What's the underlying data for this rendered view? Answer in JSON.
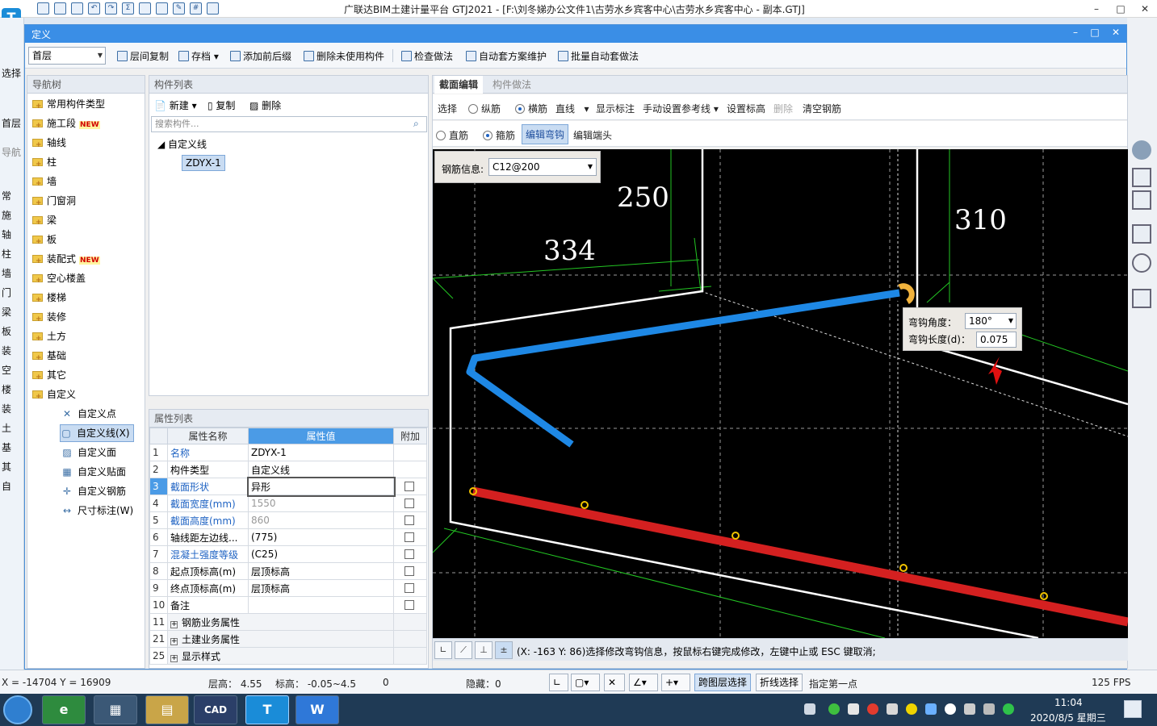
{
  "app": {
    "title": "广联达BIM土建计量平台 GTJ2021 - [F:\\刘冬娣办公文件1\\古劳水乡宾客中心\\古劳水乡宾客中心 - 副本.GTJ]",
    "logo": "T",
    "win_min": "–",
    "win_max": "□",
    "win_close": "✕",
    "bg_left_items": [
      "选择",
      "首层",
      "导航",
      "常",
      "施",
      "轴",
      "柱",
      "墙",
      "门",
      "梁",
      "板",
      "装",
      "空",
      "楼",
      "装",
      "土",
      "基",
      "其",
      "自"
    ]
  },
  "dialog": {
    "title": "定义",
    "floor": "首层",
    "toolbar": [
      "层间复制",
      "存档",
      "添加前后缀",
      "删除未使用构件",
      "检查做法",
      "自动套方案维护",
      "批量自动套做法"
    ]
  },
  "nav": {
    "header": "导航树",
    "items": [
      {
        "label": "常用构件类型",
        "new": ""
      },
      {
        "label": "施工段",
        "new": "NEW"
      },
      {
        "label": "轴线",
        "new": ""
      },
      {
        "label": "柱",
        "new": ""
      },
      {
        "label": "墙",
        "new": ""
      },
      {
        "label": "门窗洞",
        "new": ""
      },
      {
        "label": "梁",
        "new": ""
      },
      {
        "label": "板",
        "new": ""
      },
      {
        "label": "装配式",
        "new": "NEW"
      },
      {
        "label": "空心楼盖",
        "new": ""
      },
      {
        "label": "楼梯",
        "new": ""
      },
      {
        "label": "装修",
        "new": ""
      },
      {
        "label": "土方",
        "new": ""
      },
      {
        "label": "基础",
        "new": ""
      },
      {
        "label": "其它",
        "new": ""
      },
      {
        "label": "自定义",
        "new": ""
      }
    ],
    "sub_items": [
      "自定义点",
      "自定义线(X)",
      "自定义面",
      "自定义贴面",
      "自定义钢筋",
      "尺寸标注(W)"
    ]
  },
  "components": {
    "header": "构件列表",
    "new_label": "新建",
    "copy_label": "复制",
    "delete_label": "删除",
    "search_placeholder": "搜索构件...",
    "tree_root": "自定义线",
    "tree_child": "ZDYX-1"
  },
  "properties": {
    "header": "属性列表",
    "col_name": "属性名称",
    "col_value": "属性值",
    "col_extra": "附加",
    "rows": [
      {
        "n": "1",
        "name": "名称",
        "value": "ZDYX-1",
        "blue": true,
        "gray": false,
        "cb": false
      },
      {
        "n": "2",
        "name": "构件类型",
        "value": "自定义线",
        "blue": false,
        "gray": false,
        "cb": false
      },
      {
        "n": "3",
        "name": "截面形状",
        "value": "异形",
        "blue": true,
        "gray": false,
        "cb": true
      },
      {
        "n": "4",
        "name": "截面宽度(mm)",
        "value": "1550",
        "blue": true,
        "gray": true,
        "cb": true
      },
      {
        "n": "5",
        "name": "截面高度(mm)",
        "value": "860",
        "blue": true,
        "gray": true,
        "cb": true
      },
      {
        "n": "6",
        "name": "轴线距左边线...",
        "value": "(775)",
        "blue": false,
        "gray": false,
        "cb": true
      },
      {
        "n": "7",
        "name": "混凝土强度等级",
        "value": "(C25)",
        "blue": true,
        "gray": false,
        "cb": true
      },
      {
        "n": "8",
        "name": "起点顶标高(m)",
        "value": "层顶标高",
        "blue": false,
        "gray": false,
        "cb": true
      },
      {
        "n": "9",
        "name": "终点顶标高(m)",
        "value": "层顶标高",
        "blue": false,
        "gray": false,
        "cb": true
      },
      {
        "n": "10",
        "name": "备注",
        "value": "",
        "blue": false,
        "gray": false,
        "cb": true
      }
    ],
    "groups": [
      {
        "n": "11",
        "name": "钢筋业务属性"
      },
      {
        "n": "21",
        "name": "土建业务属性"
      },
      {
        "n": "25",
        "name": "显示样式"
      }
    ]
  },
  "editor": {
    "tab_active": "截面编辑",
    "tab_other": "构件做法",
    "row1": {
      "select": "选择",
      "longitudinal": "纵筋",
      "transverse": "横筋",
      "line": "直线",
      "show_mark": "显示标注",
      "manual_ref": "手动设置参考线",
      "set_elev": "设置标高",
      "delete": "删除",
      "clear": "清空钢筋"
    },
    "row2": {
      "straight": "直筋",
      "stirrup": "箍筋",
      "edit_hook": "编辑弯钩",
      "edit_end": "编辑端头"
    },
    "rebar_info_label": "钢筋信息:",
    "rebar_info_value": "C12@200",
    "dims": [
      "250",
      "334",
      "310"
    ],
    "hook_angle_label": "弯钩角度：",
    "hook_angle_value": "180°",
    "hook_len_label": "弯钩长度(d)：",
    "hook_len_value": "0.075",
    "status_msg": "(X: -163 Y: 86)选择修改弯钩信息，按鼠标右键完成修改，左键中止或 ESC 键取消;"
  },
  "statusbar": {
    "coords": "X = -14704 Y = 16909",
    "floor_h": "层高：  4.55",
    "elev": "标高：  -0.05~4.5",
    "zero": "0",
    "hidden": "隐藏：0",
    "cross_layer": "跨图层选择",
    "polyline": "折线选择",
    "first_point": "指定第一点",
    "fps": "125 FPS"
  },
  "taskbar": {
    "apps": [
      "e",
      "▦",
      "▤",
      "CAD",
      "T",
      "W"
    ],
    "time": "11:04",
    "date": "2020/8/5 星期三"
  },
  "colors": {
    "accent": "#3a8ee6",
    "rebar_blue": "#1e88e5",
    "rebar_red": "#d42020",
    "hook": "#f2b33d"
  }
}
